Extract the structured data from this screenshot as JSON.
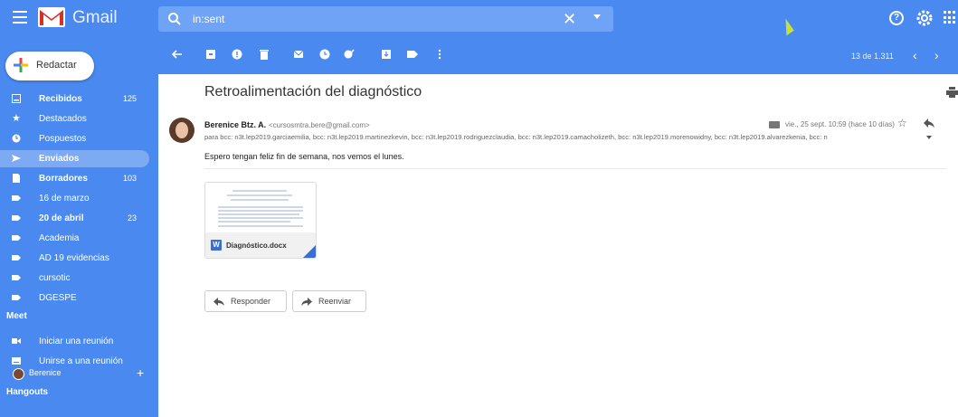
{
  "app": {
    "name": "Gmail",
    "colors": {
      "brand_blue": "#4a8af0",
      "active_bg": "#7eaaf4",
      "gmail_red": "#d93025"
    }
  },
  "search": {
    "value": "in:sent",
    "clear_icon": "close-icon"
  },
  "compose": {
    "label": "Redactar"
  },
  "sidebar": {
    "items": [
      {
        "label": "Recibidos",
        "count": "125",
        "bold": true,
        "icon": "inbox-icon"
      },
      {
        "label": "Destacados",
        "count": "",
        "bold": false,
        "icon": "star-icon"
      },
      {
        "label": "Pospuestos",
        "count": "",
        "bold": false,
        "icon": "clock-icon"
      },
      {
        "label": "Enviados",
        "count": "",
        "bold": true,
        "icon": "send-icon",
        "active": true
      },
      {
        "label": "Borradores",
        "count": "103",
        "bold": true,
        "icon": "draft-icon"
      },
      {
        "label": "16 de marzo",
        "count": "",
        "bold": false,
        "icon": "label-icon"
      },
      {
        "label": "20 de abril",
        "count": "23",
        "bold": true,
        "icon": "label-icon"
      },
      {
        "label": "Academia",
        "count": "",
        "bold": false,
        "icon": "label-icon"
      },
      {
        "label": "AD 19 evidencias",
        "count": "",
        "bold": false,
        "icon": "label-icon"
      },
      {
        "label": "cursotic",
        "count": "",
        "bold": false,
        "icon": "label-icon"
      },
      {
        "label": "DGESPE",
        "count": "",
        "bold": false,
        "icon": "label-icon"
      }
    ],
    "meet": {
      "title": "Meet",
      "items": [
        {
          "label": "Iniciar una reunión",
          "icon": "video-icon"
        },
        {
          "label": "Unirse a una reunión",
          "icon": "keyboard-icon"
        }
      ]
    },
    "hangouts": {
      "title": "Hangouts",
      "user": "Berenice"
    }
  },
  "toolbar": {
    "pager": "13 de 1.311"
  },
  "message": {
    "subject": "Retroalimentación del diagnóstico",
    "sender_name": "Berenice Btz. A.",
    "sender_email": "<cursosmtra.bere@gmail.com>",
    "date": "vie., 25 sept. 10:59 (hace 10 días)",
    "recipients": "para bcc: n3t.lep2019.garciaemilia, bcc: n3t.lep2019.martinezkevin, bcc: n3t.lep2019.rodriguezclaudia, bcc: n3t.lep2019.camacholizeth, bcc: n3t.lep2019.morenowidny, bcc: n3t.lep2019.alvarezkenia, bcc: n",
    "body": "Espero tengan feliz fin de semana, nos vemos el lunes.",
    "attachment": {
      "name": "Diagnóstico.docx",
      "type_badge": "W"
    }
  },
  "actions": {
    "reply": "Responder",
    "forward": "Reenviar"
  }
}
